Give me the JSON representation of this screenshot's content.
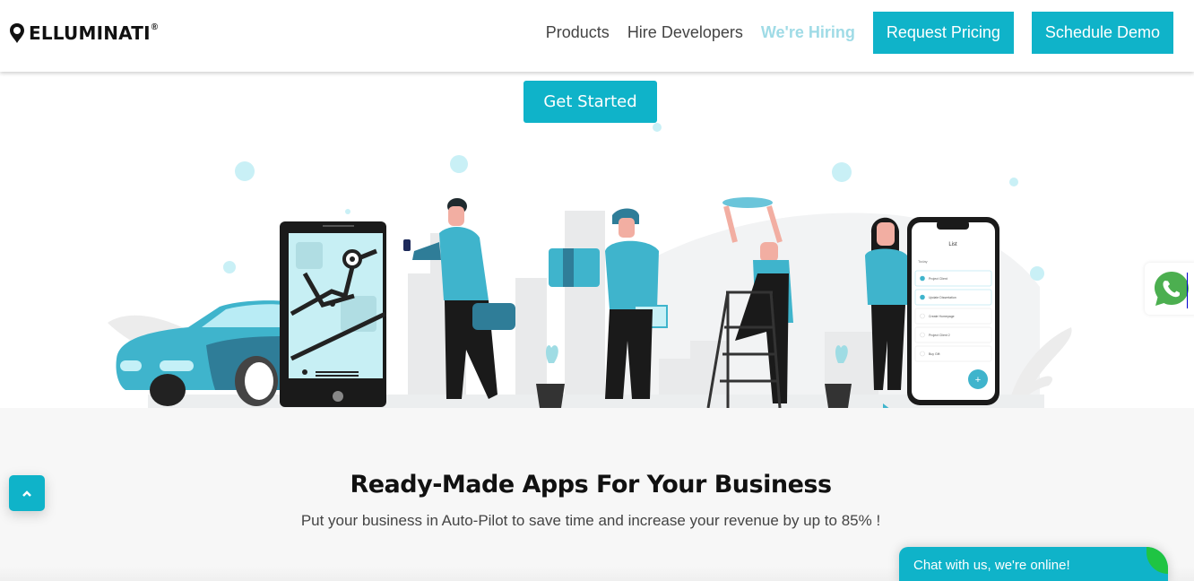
{
  "header": {
    "logo_text": "ELLUMINATI",
    "logo_mark": "®",
    "nav": [
      {
        "label": "Products"
      },
      {
        "label": "Hire Developers"
      },
      {
        "label": "We're Hiring"
      }
    ],
    "buttons": {
      "request_pricing": "Request Pricing",
      "schedule_demo": "Schedule Demo"
    }
  },
  "hero": {
    "cta_label": "Get Started",
    "illustration": {
      "phone_list": {
        "title": "List",
        "section": "Today",
        "tasks": [
          {
            "label": "Project Client",
            "done": true
          },
          {
            "label": "Update Dissertation",
            "done": true
          },
          {
            "label": "Create Homepage",
            "done": false
          },
          {
            "label": "Project Client 2",
            "done": false
          },
          {
            "label": "Buy Gift",
            "done": false
          }
        ]
      }
    }
  },
  "section": {
    "title": "Ready-Made Apps For Your Business",
    "subtitle": "Put your business in Auto-Pilot to save time and increase your revenue by up to 85% !"
  },
  "widgets": {
    "chat_label": "Chat with us, we're online!",
    "scroll_top_icon": "chevron-up-icon",
    "whatsapp_icon": "whatsapp-icon"
  },
  "colors": {
    "accent": "#0fb3c9",
    "hiring_link": "#9fdbe6",
    "online_dot": "#1fc443",
    "whatsapp": "#4caf50"
  }
}
